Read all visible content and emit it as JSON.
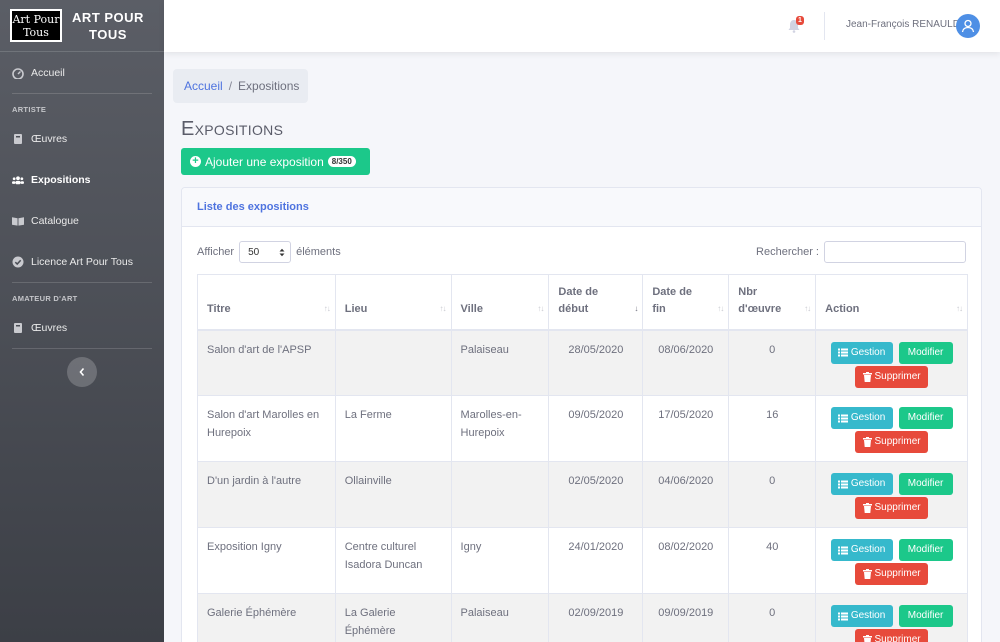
{
  "brand": {
    "logo_line1": "Art Pour",
    "logo_line2": "Tous",
    "name_line1": "ART POUR",
    "name_line2": "TOUS"
  },
  "sidebar": {
    "home": "Accueil",
    "section_artist": "ARTISTE",
    "artist_items": [
      "Œuvres",
      "Expositions",
      "Catalogue",
      "Licence Art Pour Tous"
    ],
    "section_amateur": "AMATEUR D'ART",
    "amateur_items": [
      "Œuvres"
    ]
  },
  "topbar": {
    "notifications": "1",
    "user": "Jean-François RENAULD"
  },
  "breadcrumb": {
    "home": "Accueil",
    "current": "Expositions"
  },
  "page": {
    "title": "Expositions",
    "add_label": "Ajouter une exposition",
    "add_count": "8/350"
  },
  "card": {
    "title": "Liste des expositions"
  },
  "controls": {
    "show_prefix": "Afficher",
    "page_size": "50",
    "show_suffix": "éléments",
    "search_label": "Rechercher :"
  },
  "table": {
    "columns": [
      "Titre",
      "Lieu",
      "Ville",
      "Date de début",
      "Date de fin",
      "Nbr d'œuvre",
      "Action"
    ],
    "actions": {
      "manage": "Gestion",
      "edit": "Modifier",
      "delete": "Supprimer"
    },
    "rows": [
      {
        "title": "Salon d'art de l'APSP",
        "place": "",
        "city": "Palaiseau",
        "start": "28/05/2020",
        "end": "08/06/2020",
        "count": "0"
      },
      {
        "title": "Salon d'art Marolles en Hurepoix",
        "place": "La Ferme",
        "city": "Marolles-en-Hurepoix",
        "start": "09/05/2020",
        "end": "17/05/2020",
        "count": "16"
      },
      {
        "title": "D'un jardin à l'autre",
        "place": "Ollainville",
        "city": "",
        "start": "02/05/2020",
        "end": "04/06/2020",
        "count": "0"
      },
      {
        "title": "Exposition Igny",
        "place": "Centre culturel Isadora Duncan",
        "city": "Igny",
        "start": "24/01/2020",
        "end": "08/02/2020",
        "count": "40"
      },
      {
        "title": "Galerie Éphémère",
        "place": "La Galerie Éphémère",
        "city": "Palaiseau",
        "start": "02/09/2019",
        "end": "09/09/2019",
        "count": "0"
      }
    ]
  }
}
